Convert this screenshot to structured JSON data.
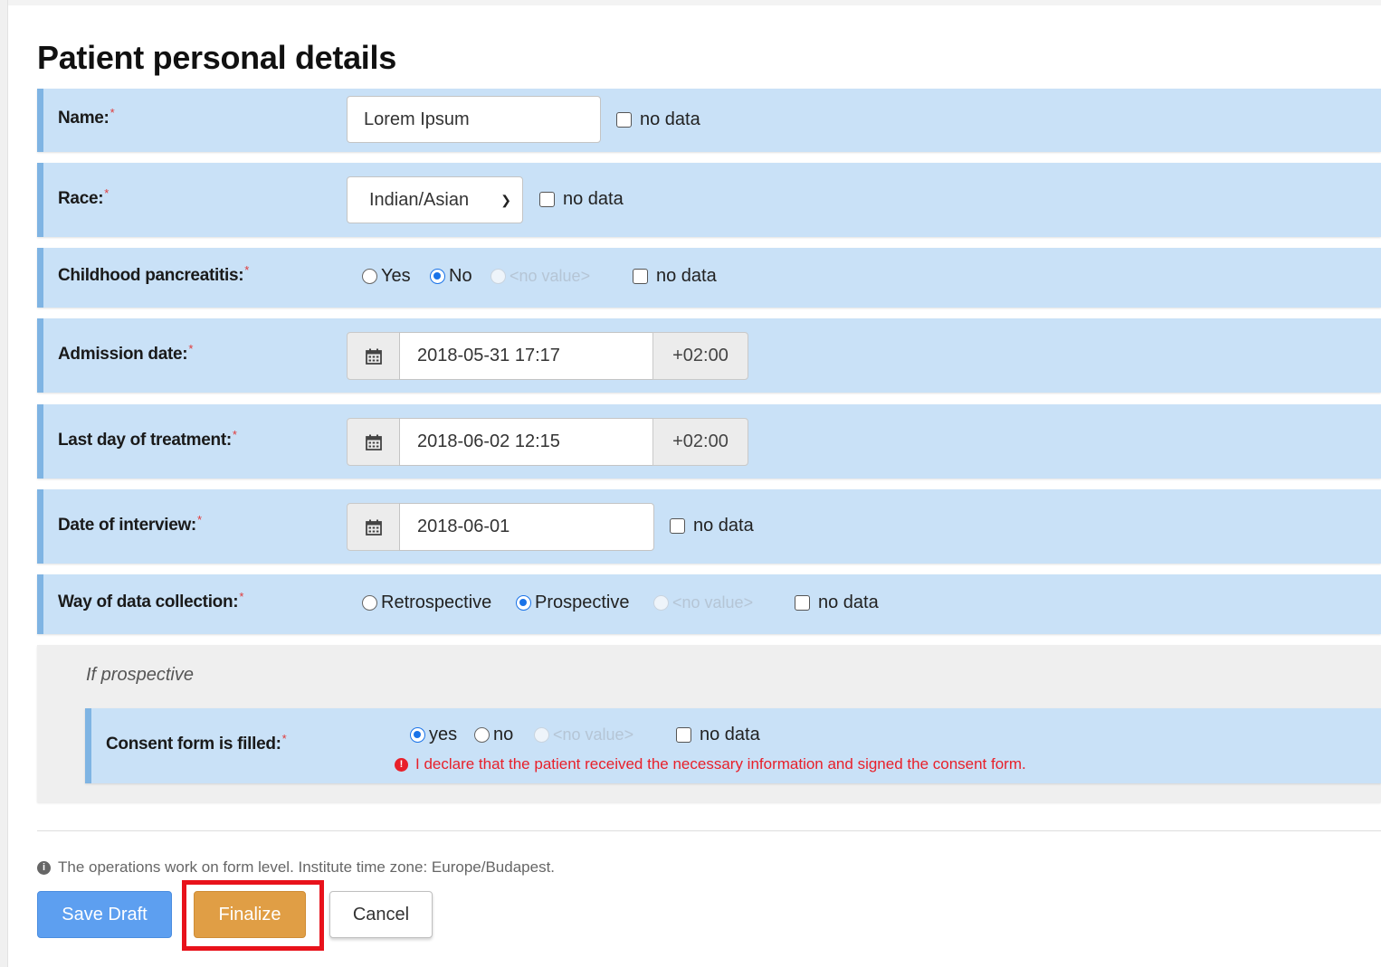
{
  "page_title": "Patient personal details",
  "required_mark": "*",
  "fields": {
    "name": {
      "label": "Name:",
      "value": "Lorem Ipsum",
      "no_data_label": "no data"
    },
    "race": {
      "label": "Race:",
      "selected": "Indian/Asian",
      "no_data_label": "no data"
    },
    "childhood_pancreatitis": {
      "label": "Childhood pancreatitis:",
      "options": [
        "Yes",
        "No",
        "<no value>"
      ],
      "selected": "No",
      "no_data_label": "no data"
    },
    "admission_date": {
      "label": "Admission date:",
      "value": "2018-05-31 17:17",
      "tz": "+02:00"
    },
    "last_day_treatment": {
      "label": "Last day of treatment:",
      "value": "2018-06-02 12:15",
      "tz": "+02:00"
    },
    "date_of_interview": {
      "label": "Date of interview:",
      "value": "2018-06-01",
      "no_data_label": "no data"
    },
    "way_of_collection": {
      "label": "Way of data collection:",
      "options": [
        "Retrospective",
        "Prospective",
        "<no value>"
      ],
      "selected": "Prospective",
      "no_data_label": "no data"
    }
  },
  "prospective_section": {
    "title": "If prospective",
    "consent": {
      "label": "Consent form is filled:",
      "options": [
        "yes",
        "no",
        "<no value>"
      ],
      "selected": "yes",
      "no_data_label": "no data",
      "warning": "I declare that the patient received the necessary information and signed the consent form."
    }
  },
  "info_text": "The operations work on form level. Institute time zone: Europe/Budapest.",
  "buttons": {
    "save_draft": "Save Draft",
    "finalize": "Finalize",
    "cancel": "Cancel"
  },
  "colors": {
    "row_bg": "#c9e1f7",
    "row_accent": "#7fb4e3",
    "primary": "#5d9ff0",
    "finalize": "#e09e45",
    "warning": "#e8202a",
    "highlight": "#e8121b"
  }
}
